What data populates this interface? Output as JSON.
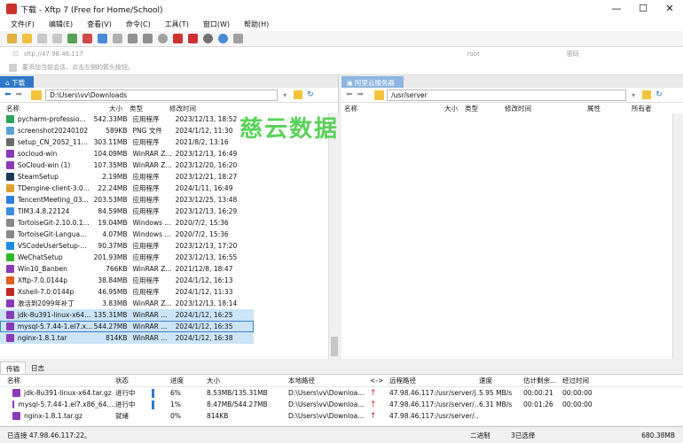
{
  "window": {
    "title": "下载 - Xftp 7 (Free for Home/School)",
    "controls": [
      "—",
      "☐",
      "✕"
    ]
  },
  "menu": [
    "文件(F)",
    "编辑(E)",
    "查看(V)",
    "命令(C)",
    "工具(T)",
    "窗口(W)",
    "帮助(H)"
  ],
  "address": {
    "host": "sftp://47.98.46.117",
    "user_placeholder": "root",
    "pass_placeholder": "密码"
  },
  "hint": "要添加当前会话，点击左侧的箭头按钮。",
  "watermark": "慈云数据",
  "local": {
    "tab": "下载",
    "path": "D:\\Users\\vv\\Downloads",
    "columns": [
      "名称",
      "大小",
      "类型",
      "修改时间"
    ],
    "files": [
      {
        "name": "pycharm-professio...",
        "size": "542.33MB",
        "type": "应用程序",
        "date": "2023/12/13, 18:52",
        "icon": "#2ba35a"
      },
      {
        "name": "screenshot20240102",
        "size": "589KB",
        "type": "PNG 文件",
        "date": "2024/1/12, 11:30",
        "icon": "#5aa0d8"
      },
      {
        "name": "setup_CN_2052_11...",
        "size": "303.11MB",
        "type": "应用程序",
        "date": "2021/8/2, 13:16",
        "icon": "#6c6c6c"
      },
      {
        "name": "socloud-win",
        "size": "104.09MB",
        "type": "WinRAR Z...",
        "date": "2023/12/13, 16:49",
        "icon": "#8a3ab9"
      },
      {
        "name": "SoCloud-win (1)",
        "size": "107.35MB",
        "type": "WinRAR Z...",
        "date": "2023/12/20, 16:20",
        "icon": "#8a3ab9"
      },
      {
        "name": "SteamSetup",
        "size": "2.19MB",
        "type": "应用程序",
        "date": "2023/12/21, 18:27",
        "icon": "#1b3a5c"
      },
      {
        "name": "TDengine-client-3.0...",
        "size": "22.24MB",
        "type": "应用程序",
        "date": "2024/1/11, 16:49",
        "icon": "#e0a030"
      },
      {
        "name": "TencentMeeting_03...",
        "size": "203.53MB",
        "type": "应用程序",
        "date": "2023/12/25, 13:48",
        "icon": "#2f7fe0"
      },
      {
        "name": "TIM3.4.8.22124",
        "size": "84.59MB",
        "type": "应用程序",
        "date": "2023/12/13, 16:29",
        "icon": "#3a8ee0"
      },
      {
        "name": "TortoiseGit-2.10.0.1...",
        "size": "19.04MB",
        "type": "Windows ...",
        "date": "2020/7/2, 15:36",
        "icon": "#888888"
      },
      {
        "name": "TortoiseGit-Langua...",
        "size": "4.07MB",
        "type": "Windows ...",
        "date": "2020/7/2, 15:36",
        "icon": "#888888"
      },
      {
        "name": "VSCodeUserSetup-...",
        "size": "90.37MB",
        "type": "应用程序",
        "date": "2023/12/13, 17:20",
        "icon": "#1e88e5"
      },
      {
        "name": "WeChatSetup",
        "size": "201.93MB",
        "type": "应用程序",
        "date": "2023/12/13, 16:55",
        "icon": "#2eb82e"
      },
      {
        "name": "Win10_Banben",
        "size": "766KB",
        "type": "WinRAR Z...",
        "date": "2021/12/8, 18:47",
        "icon": "#8a3ab9"
      },
      {
        "name": "Xftp-7.0.0144p",
        "size": "38.84MB",
        "type": "应用程序",
        "date": "2024/1/12, 16:13",
        "icon": "#e06020"
      },
      {
        "name": "Xshell-7.0.0144p",
        "size": "46.95MB",
        "type": "应用程序",
        "date": "2024/1/12, 11:33",
        "icon": "#c02828"
      },
      {
        "name": "激活到2099年补丁",
        "size": "3.83MB",
        "type": "WinRAR Z...",
        "date": "2023/12/13, 18:14",
        "icon": "#8a3ab9"
      },
      {
        "name": "jdk-8u391-linux-x64...",
        "size": "135.31MB",
        "type": "WinRAR ...",
        "date": "2024/1/12, 16:25",
        "icon": "#8a3ab9",
        "selected": true
      },
      {
        "name": "mysql-5.7.44-1.el7.x...",
        "size": "544.27MB",
        "type": "WinRAR ...",
        "date": "2024/1/12, 16:35",
        "icon": "#8a3ab9",
        "selected": true,
        "focus": true
      },
      {
        "name": "nginx-1.8.1.tar",
        "size": "814KB",
        "type": "WinRAR ...",
        "date": "2024/1/12, 16:38",
        "icon": "#8a3ab9",
        "selected": true
      }
    ]
  },
  "remote": {
    "tab": "阿里云服务器",
    "path": "/usr/server",
    "columns": [
      "名称",
      "大小",
      "类型",
      "修改时间",
      "属性",
      "所有者"
    ]
  },
  "bottom_tabs": [
    "传输",
    "日志"
  ],
  "transfers": {
    "columns": [
      "名称",
      "状态",
      "进度",
      "大小",
      "本地路径",
      "<->",
      "远程路径",
      "速度",
      "估计剩余...",
      "经过时间"
    ],
    "rows": [
      {
        "name": "jdk-8u391-linux-x64.tar.gz",
        "status": "进行中",
        "progress": "6%",
        "progress_value": 6,
        "size": "8.53MB/135.31MB",
        "local": "D:\\Users\\vv\\Downloa...",
        "dir": "↑",
        "remote": "47.98.46.117:/usr/server/j...",
        "speed": "5.95 MB/s",
        "eta": "00:00:21",
        "elapsed": "00:00:00"
      },
      {
        "name": "mysql-5.7.44-1.el7.x86_64....",
        "status": "进行中",
        "progress": "1%",
        "progress_value": 1,
        "size": "8.47MB/544.27MB",
        "local": "D:\\Users\\vv\\Downloa...",
        "dir": "↑",
        "remote": "47.98.46.117:/usr/server/...",
        "speed": "6.31 MB/s",
        "eta": "00:01:26",
        "elapsed": "00:00:00"
      },
      {
        "name": "nginx-1.8.1.tar.gz",
        "status": "就绪",
        "progress": "0%",
        "progress_value": 0,
        "size": "814KB",
        "local": "D:\\Users\\vv\\Downloa...",
        "dir": "↑",
        "remote": "47.98.46.117:/usr/server/...",
        "speed": "",
        "eta": "",
        "elapsed": ""
      }
    ]
  },
  "status": {
    "left": "已连接 47.98.46.117:22。",
    "mode": "二进制",
    "count": "3已选择",
    "size": "680.38MB"
  }
}
